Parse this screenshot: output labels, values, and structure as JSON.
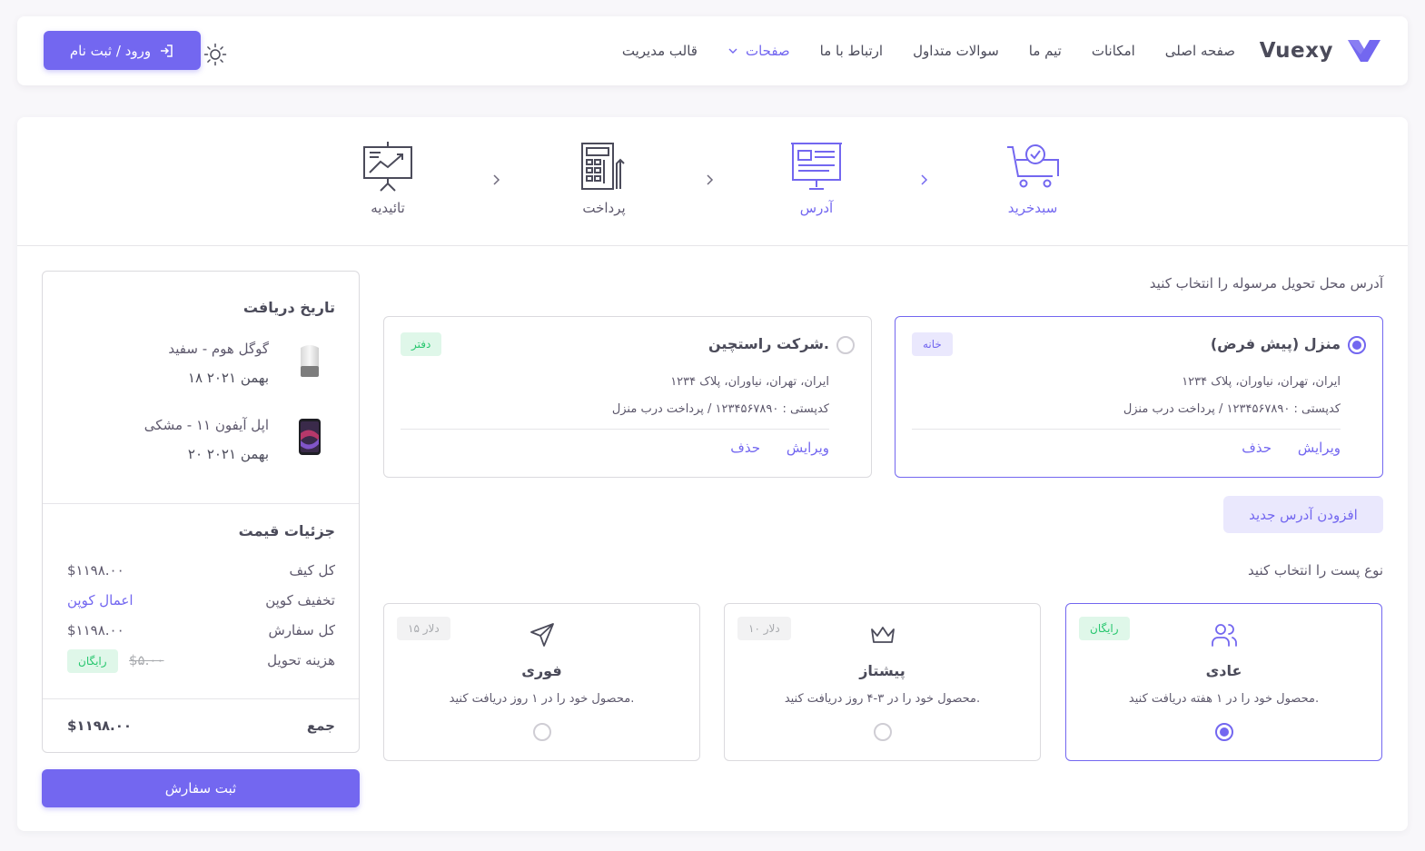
{
  "navbar": {
    "brand": "Vuexy",
    "menu": [
      "صفحه اصلی",
      "امکانات",
      "تیم ما",
      "سوالات متداول",
      "ارتباط با ما",
      "صفحات",
      "قالب مدیریت"
    ],
    "login_label": "ورود / ثبت نام"
  },
  "steps": [
    {
      "label": "سبدخرید",
      "icon": "cart-check-icon",
      "active": true
    },
    {
      "label": "آدرس",
      "icon": "address-icon",
      "active": true
    },
    {
      "label": "پرداخت",
      "icon": "payment-icon",
      "active": false
    },
    {
      "label": "تائیدیه",
      "icon": "presentation-chart-icon",
      "active": false
    }
  ],
  "address": {
    "title": "آدرس محل تحویل مرسوله را انتخاب کنید",
    "cards": [
      {
        "name": "منزل (پیش فرض)",
        "badge": "خانه",
        "line1": "ایران، تهران، نیاوران، پلاک ۱۲۳۴",
        "line2": "کدپستی : ۱۲۳۴۵۶۷۸۹۰ / پرداخت درب منزل",
        "edit": "ویرایش",
        "delete": "حذف",
        "selected": true
      },
      {
        "name": "شرکت راستچین.",
        "badge": "دفتر",
        "line1": "ایران، تهران، نیاوران، پلاک ۱۲۳۴",
        "line2": "کدپستی : ۱۲۳۴۵۶۷۸۹۰ / پرداخت درب منزل",
        "edit": "ویرایش",
        "delete": "حذف",
        "selected": false
      }
    ],
    "add_label": "افزودن آدرس جدید"
  },
  "shipping": {
    "title": "نوع پست را انتخاب کنید",
    "options": [
      {
        "title": "عادی",
        "desc": "محصول خود را در ۱ هفته دریافت کنید.",
        "price": "رایگان",
        "icon": "users-icon",
        "selected": true
      },
      {
        "title": "پیشتاز",
        "desc": "محصول خود را در ۳-۴ روز دریافت کنید.",
        "price": "۱۰ دلار",
        "icon": "crown-icon",
        "selected": false
      },
      {
        "title": "فوری",
        "desc": "محصول خود را در ۱ روز دریافت کنید.",
        "price": "۱۵ دلار",
        "icon": "send-icon",
        "selected": false
      }
    ]
  },
  "summary": {
    "delivery_title": "تاریخ دریافت",
    "products": [
      {
        "name": "گوگل هوم - سفید",
        "date": "۱۸ بهمن ۲۰۲۱"
      },
      {
        "name": "اپل آیفون ۱۱ - مشکی",
        "date": "۲۰ بهمن ۲۰۲۱"
      }
    ],
    "price_title": "جزئیات قیمت",
    "rows": {
      "bag_label": "کل کیف",
      "bag_value": "$۱۱۹۸.۰۰",
      "coupon_label": "تخفیف کوپن",
      "coupon_value": "اعمال کوپن",
      "order_label": "کل سفارش",
      "order_value": "$۱۱۹۸.۰۰",
      "delivery_label": "هزینه تحویل",
      "delivery_old": "$۵.۰۰",
      "delivery_badge": "رایگان"
    },
    "total_label": "جمع",
    "total_value": "$۱۱۹۸.۰۰",
    "submit_label": "ثبت سفارش"
  },
  "colors": {
    "primary": "#7367f0",
    "success": "#28c76f",
    "text": "#5d586c"
  }
}
